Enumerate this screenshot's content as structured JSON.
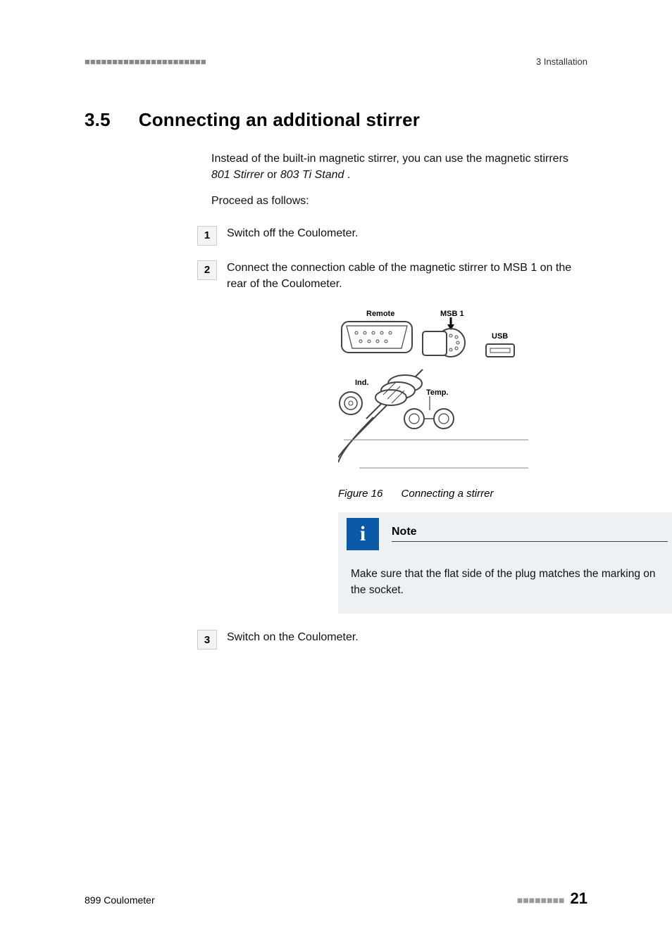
{
  "header": {
    "left_marks": "■■■■■■■■■■■■■■■■■■■■■■",
    "right": "3 Installation"
  },
  "section": {
    "num": "3.5",
    "title": "Connecting an additional stirrer"
  },
  "intro": {
    "line1_prefix": "Instead of the built-in magnetic stirrer, you can use the magnetic stirrers ",
    "product1": "801 Stirrer",
    "or": " or ",
    "product2": "803 Ti Stand",
    "period": ".",
    "proceed": "Proceed as follows:"
  },
  "steps": {
    "s1": {
      "num": "1",
      "text": "Switch off the Coulometer."
    },
    "s2": {
      "num": "2",
      "text": "Connect the connection cable of the magnetic stirrer to MSB 1 on the rear of the Coulometer."
    },
    "s3": {
      "num": "3",
      "text": "Switch on the Coulometer."
    }
  },
  "figure": {
    "labels": {
      "remote": "Remote",
      "msb1": "MSB 1",
      "usb": "USB",
      "ind": "Ind.",
      "temp": "Temp."
    },
    "caption_label": "Figure 16",
    "caption_text": "Connecting a stirrer"
  },
  "note": {
    "icon_hint": "info-icon",
    "title": "Note",
    "body": "Make sure that the flat side of the plug matches the marking on the socket."
  },
  "footer": {
    "left": "899 Coulometer",
    "right_marks": "■■■■■■■■",
    "page": "21"
  }
}
